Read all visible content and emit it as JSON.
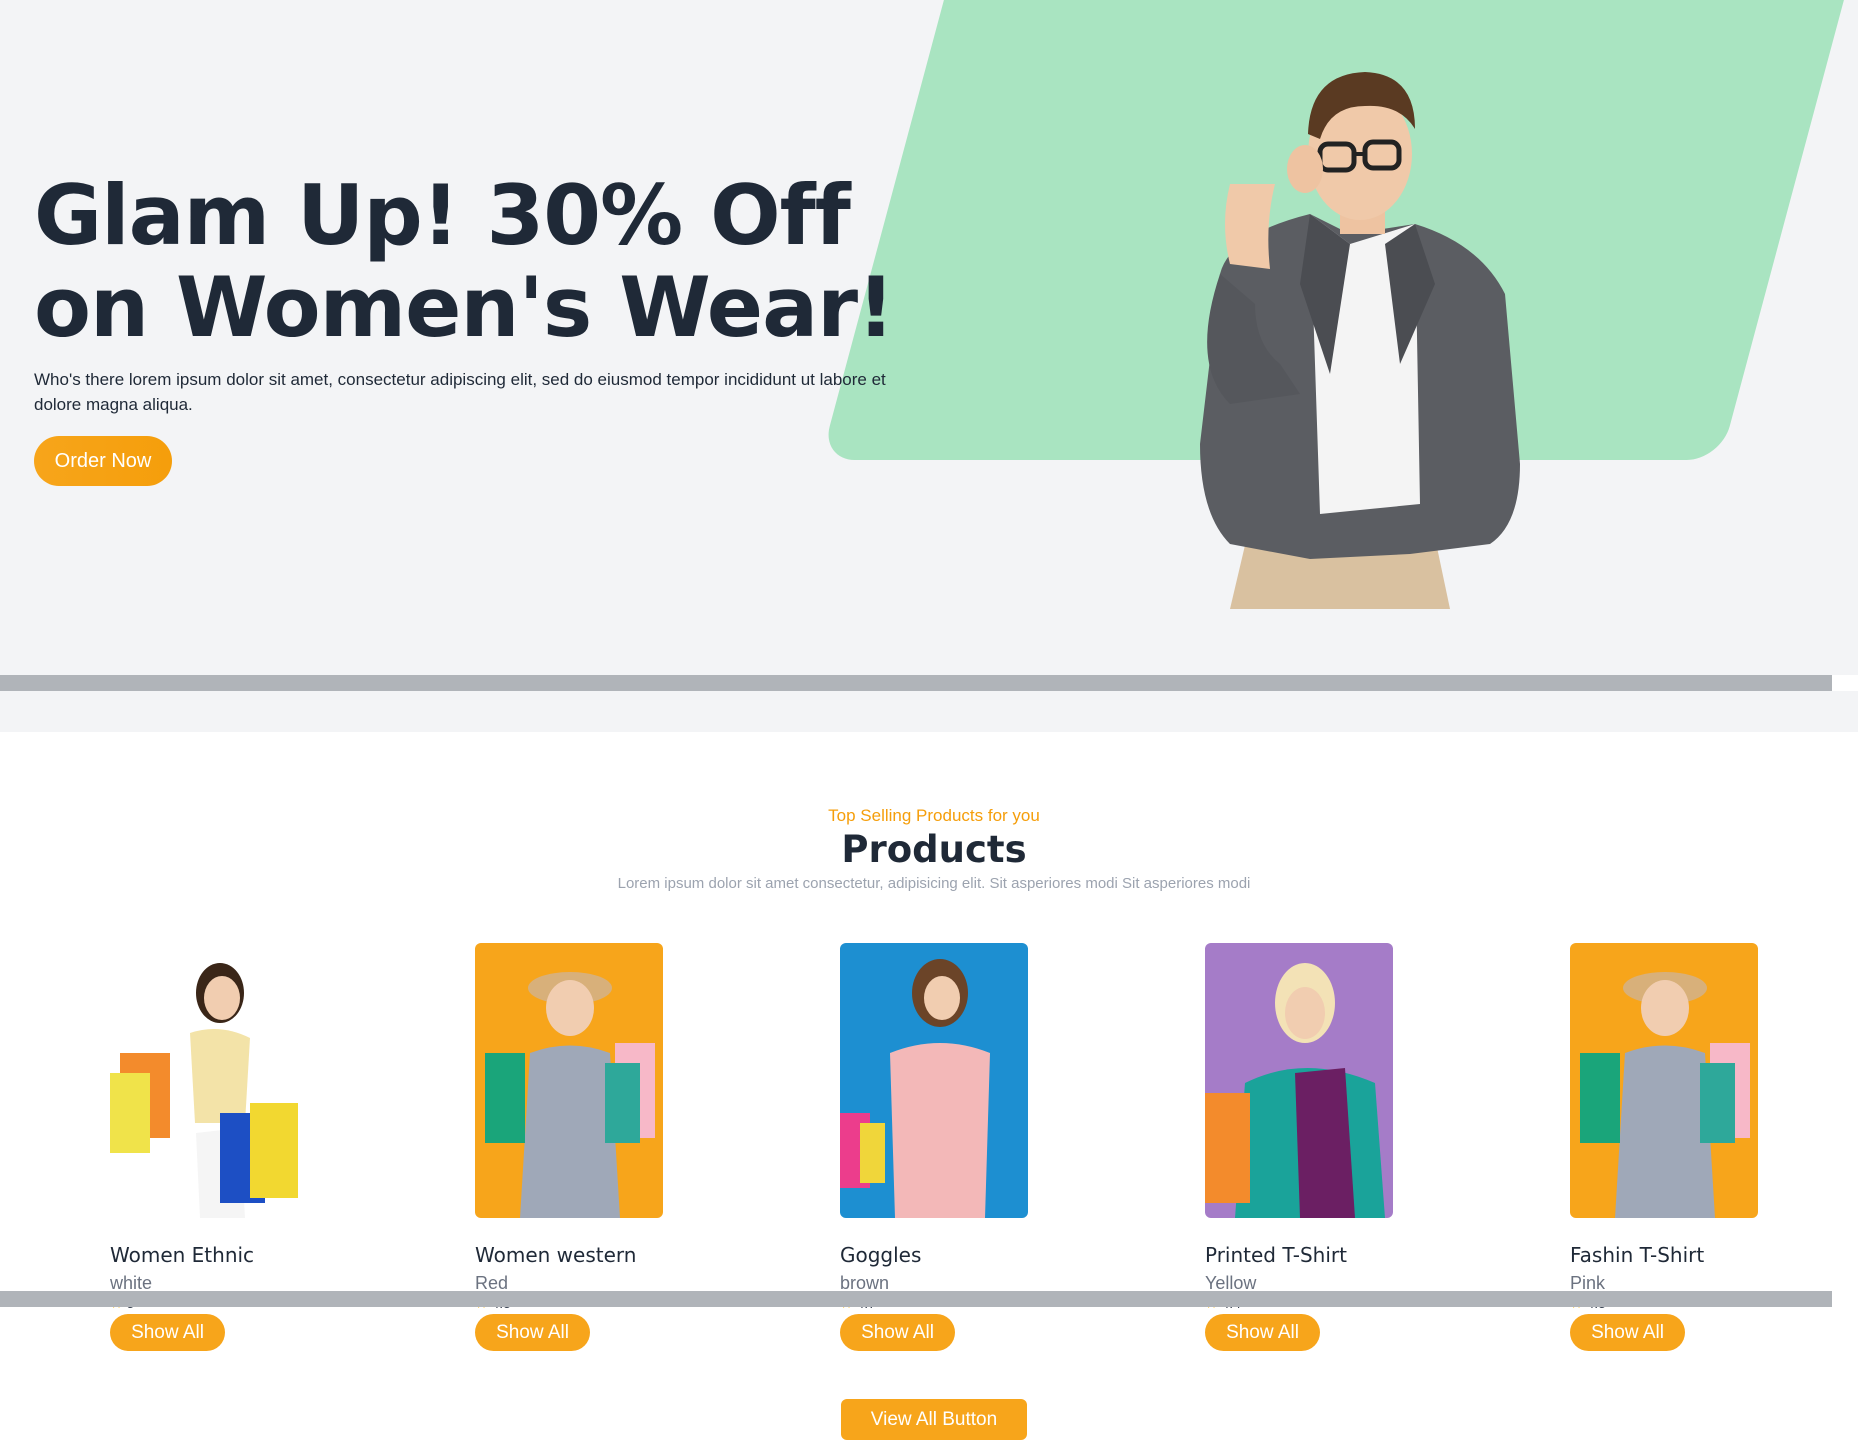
{
  "hero": {
    "title": "Glam Up! 30% Off on Women's Wear!",
    "description": "Who's there lorem ipsum dolor sit amet, consectetur adipiscing elit, sed do eiusmod tempor incididunt ut labore et dolore magna aliqua.",
    "order_button": "Order Now",
    "accent_color": "#a9e4c1"
  },
  "products_section": {
    "subtitle": "Top Selling Products for you",
    "title": "Products",
    "description": "Lorem ipsum dolor sit amet consectetur, adipisicing elit. Sit asperiores modi Sit asperiores modi",
    "view_all_button": "View All Button"
  },
  "products": [
    {
      "name": "Women Ethnic",
      "color": "white",
      "rating": "5",
      "button": "Show All",
      "image_bg": "transparent"
    },
    {
      "name": "Women western",
      "color": "Red",
      "rating": "4.5",
      "button": "Show All",
      "image_bg": "#f7a51b"
    },
    {
      "name": "Goggles",
      "color": "brown",
      "rating": "4.7",
      "button": "Show All",
      "image_bg": "#1d8fd1"
    },
    {
      "name": "Printed T-Shirt",
      "color": "Yellow",
      "rating": "4.4",
      "button": "Show All",
      "image_bg": "#a57cc8"
    },
    {
      "name": "Fashin T-Shirt",
      "color": "Pink",
      "rating": "4.5",
      "button": "Show All",
      "image_bg": "#f7a51b"
    }
  ],
  "colors": {
    "primary": "#f7a51b",
    "dark_text": "#1f2937",
    "muted_text": "#9ca3af"
  }
}
